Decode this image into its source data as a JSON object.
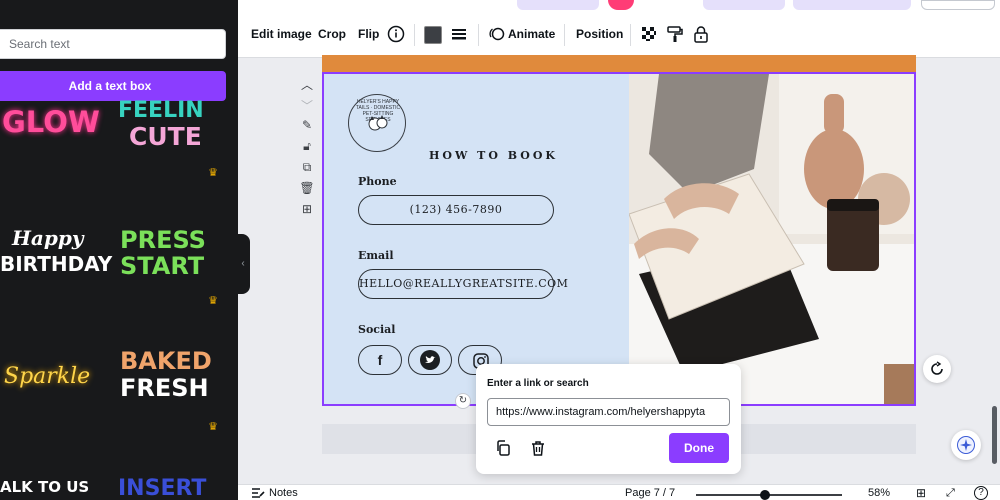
{
  "left_panel": {
    "search_placeholder": "Search text",
    "add_text_label": "Add a text box",
    "stickers": [
      "GLOW",
      "FEELIN",
      "CUTE",
      "Happy",
      "BIRTHDAY",
      "PRESS",
      "START",
      "Sparkle",
      "BAKED",
      "FRESH",
      "ALK TO US",
      "INSERT"
    ]
  },
  "toolbar": {
    "edit_image": "Edit image",
    "crop": "Crop",
    "flip": "Flip",
    "animate": "Animate",
    "position": "Position"
  },
  "design": {
    "logo_text": "HELYER'S HAPPY TAILS · DOMESTIC PET-SITTING SERVICES",
    "heading": "HOW TO BOOK",
    "phone_label": "Phone",
    "phone_value": "(123) 456-7890",
    "email_label": "Email",
    "email_value": "HELLO@REALLYGREATSITE.COM",
    "social_label": "Social",
    "social_icons": [
      "facebook-icon",
      "twitter-icon",
      "instagram-icon"
    ]
  },
  "link_popover": {
    "title": "Enter a link or search",
    "input_value": "https://www.instagram.com/helyershappyta",
    "done_label": "Done"
  },
  "bottom_bar": {
    "notes_label": "Notes",
    "page_label": "Page 7 / 7",
    "zoom_label": "58%",
    "zoom_level": 0.58
  },
  "colors": {
    "accent": "#8b3dff",
    "panel": "#18191b",
    "design_blue": "#d4e3f5",
    "orange": "#e08a3c"
  }
}
